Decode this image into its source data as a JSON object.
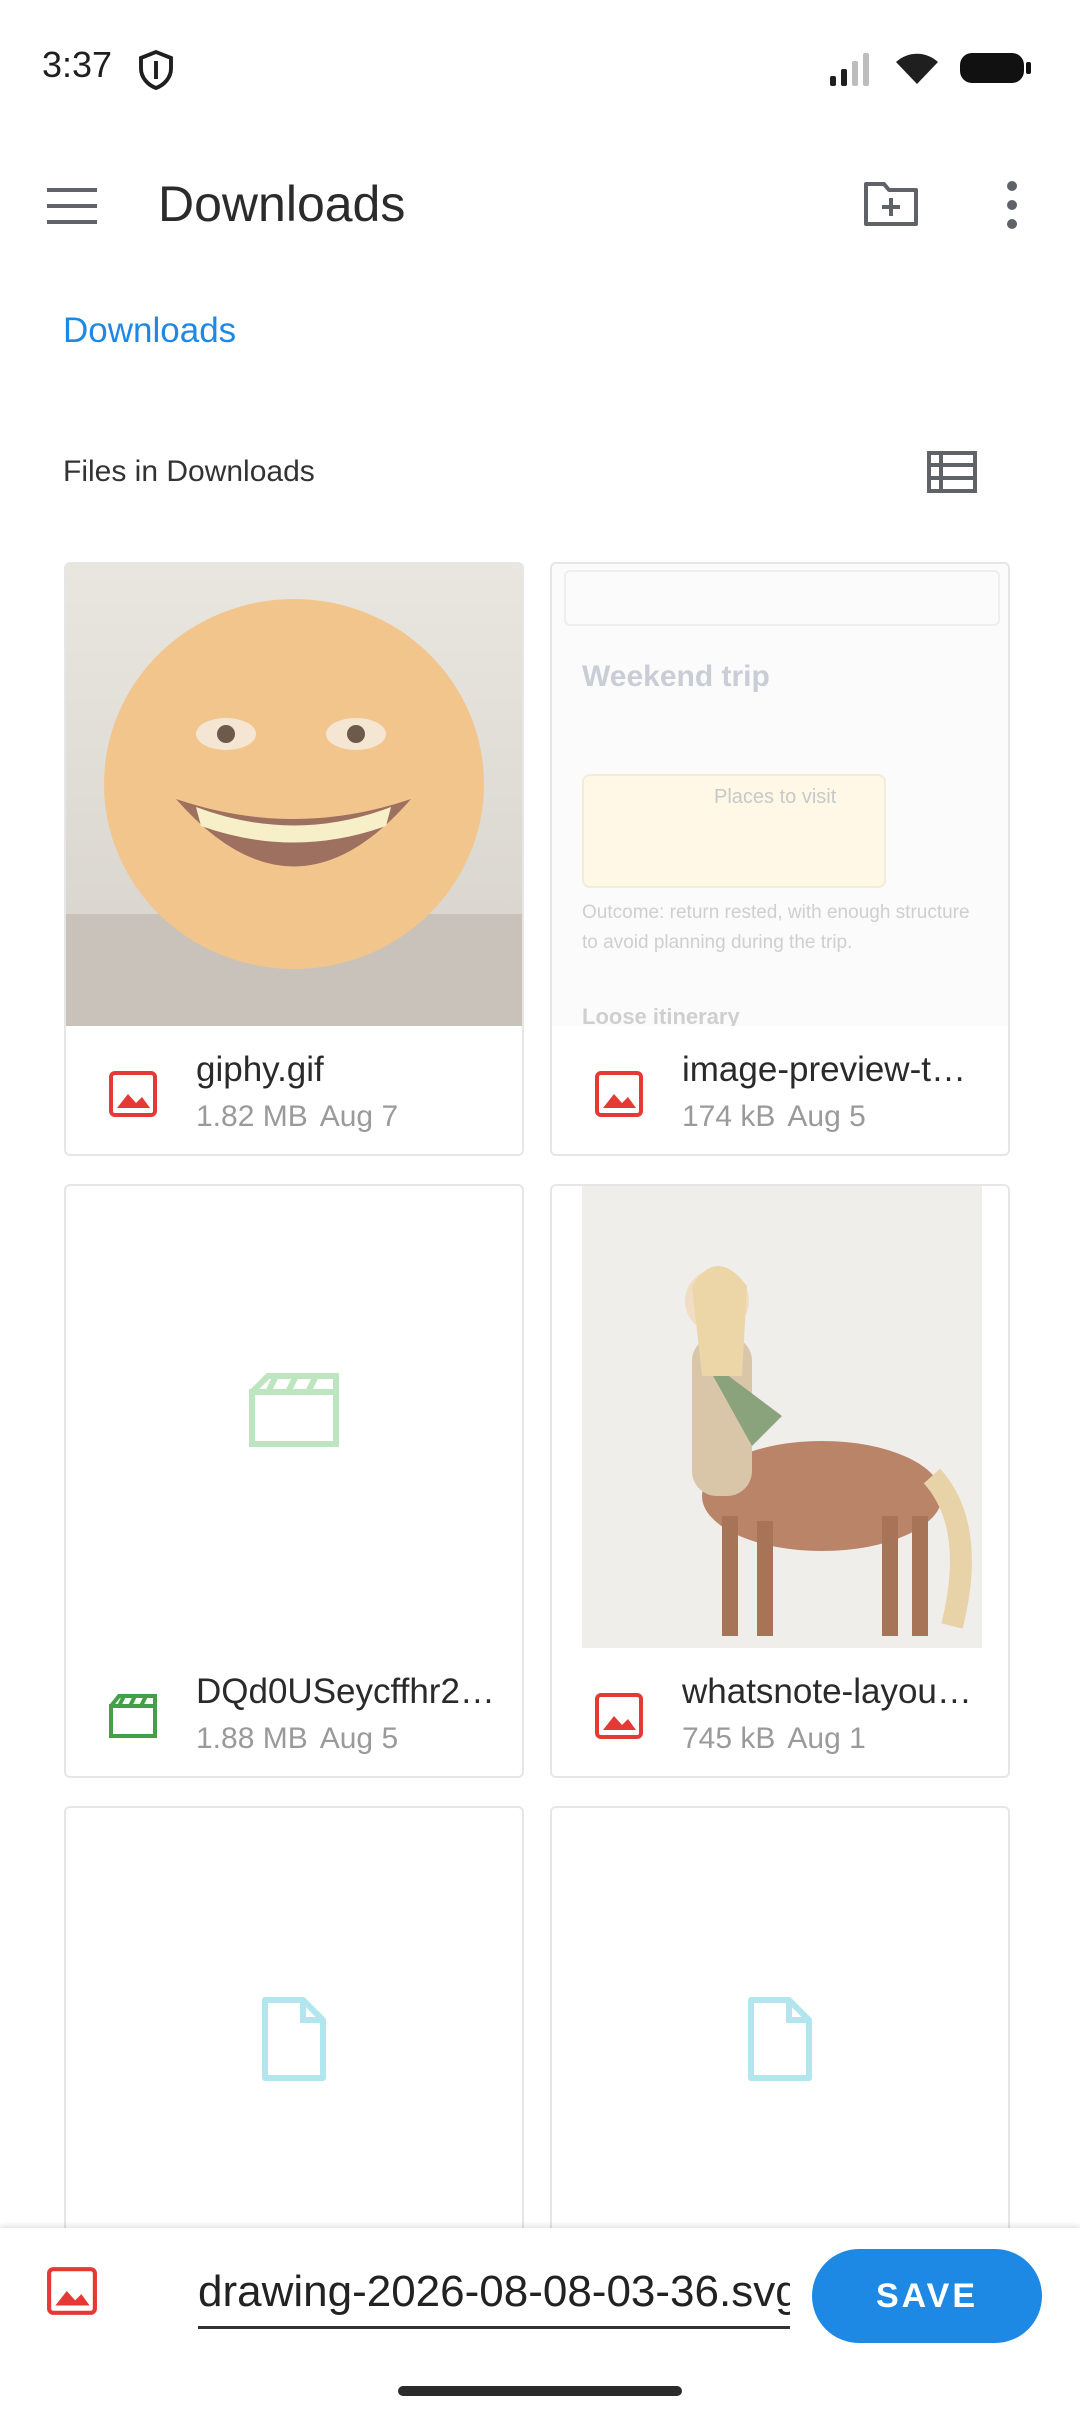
{
  "status_bar": {
    "time": "3:37"
  },
  "toolbar": {
    "title": "Downloads"
  },
  "breadcrumb": "Downloads",
  "section": {
    "title": "Files in Downloads"
  },
  "files": [
    {
      "name": "giphy.gif",
      "size": "1.82 MB",
      "date": "Aug 7",
      "type": "image"
    },
    {
      "name": "image-preview-t…",
      "size": "174 kB",
      "date": "Aug 5",
      "type": "image",
      "preview": {
        "title": "Weekend trip",
        "places": "Places to visit",
        "outcome": "Outcome: return rested, with enough structure to avoid planning during the trip.",
        "heading": "Loose itinerary"
      }
    },
    {
      "name": "DQd0USeycffhr2…",
      "size": "1.88 MB",
      "date": "Aug 5",
      "type": "video"
    },
    {
      "name": "whatsnote-layou…",
      "size": "745 kB",
      "date": "Aug 1",
      "type": "image"
    },
    {
      "name": "",
      "type": "document"
    },
    {
      "name": "",
      "type": "document"
    }
  ],
  "bottom": {
    "filename": "drawing-2026-08-08-03-36.svg",
    "save_label": "SAVE"
  },
  "colors": {
    "accent": "#1e88e5",
    "image_icon": "#e53935",
    "video_icon": "#43a047",
    "doc_icon": "#4dd0e1"
  }
}
